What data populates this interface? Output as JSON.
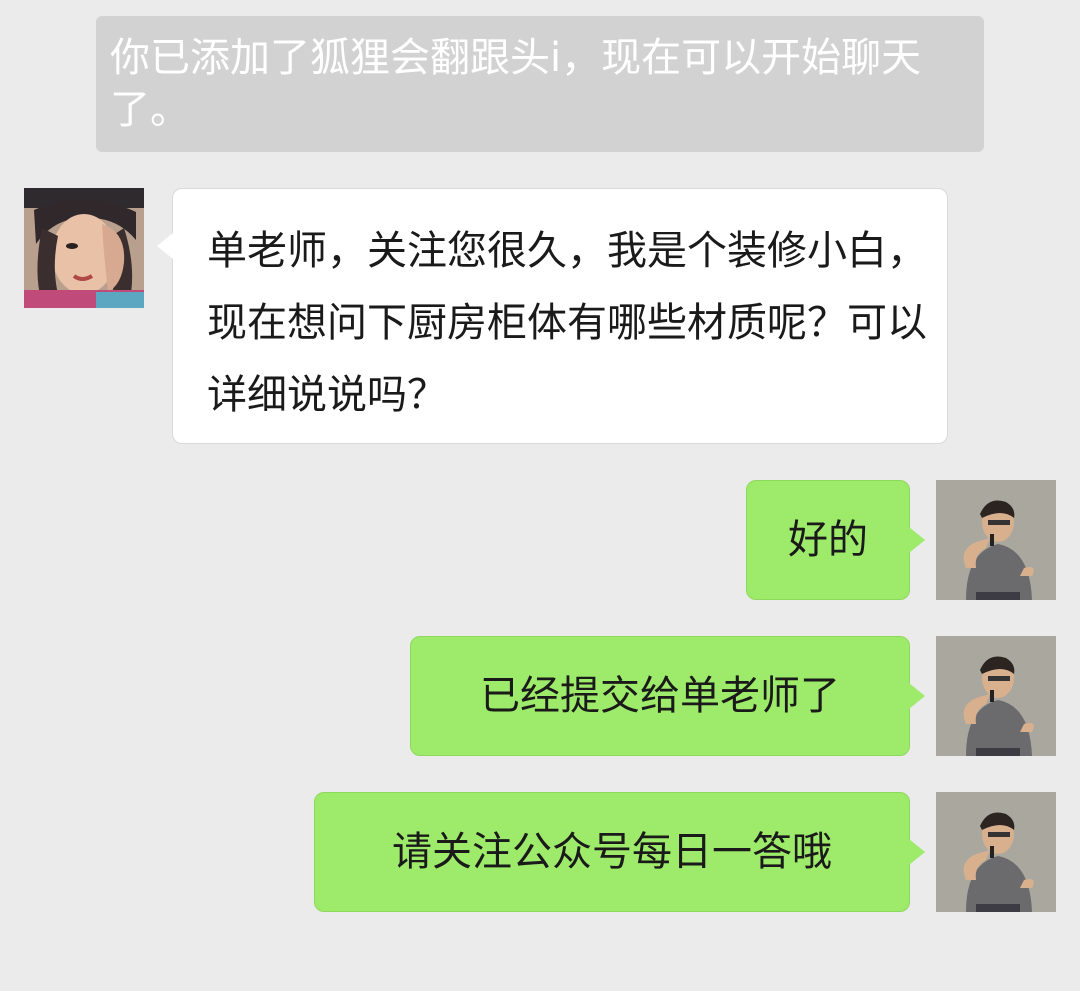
{
  "system_notice": {
    "text": "你已添加了狐狸会翻跟头i，现在可以开始聊天了。"
  },
  "messages": [
    {
      "direction": "incoming",
      "avatar_icon": "female-contact-avatar",
      "text": "单老师，关注您很久，我是个装修小白，现在想问下厨房柜体有哪些材质呢？可以详细说说吗？"
    },
    {
      "direction": "outgoing",
      "avatar_icon": "male-speaker-avatar",
      "text": "好的"
    },
    {
      "direction": "outgoing",
      "avatar_icon": "male-speaker-avatar",
      "text": "已经提交给单老师了"
    },
    {
      "direction": "outgoing",
      "avatar_icon": "male-speaker-avatar",
      "text": "请关注公众号每日一答哦"
    }
  ],
  "colors": {
    "background": "#ebebeb",
    "system_notice_bg": "#d2d2d2",
    "incoming_bubble": "#ffffff",
    "outgoing_bubble": "#9eea6a"
  }
}
